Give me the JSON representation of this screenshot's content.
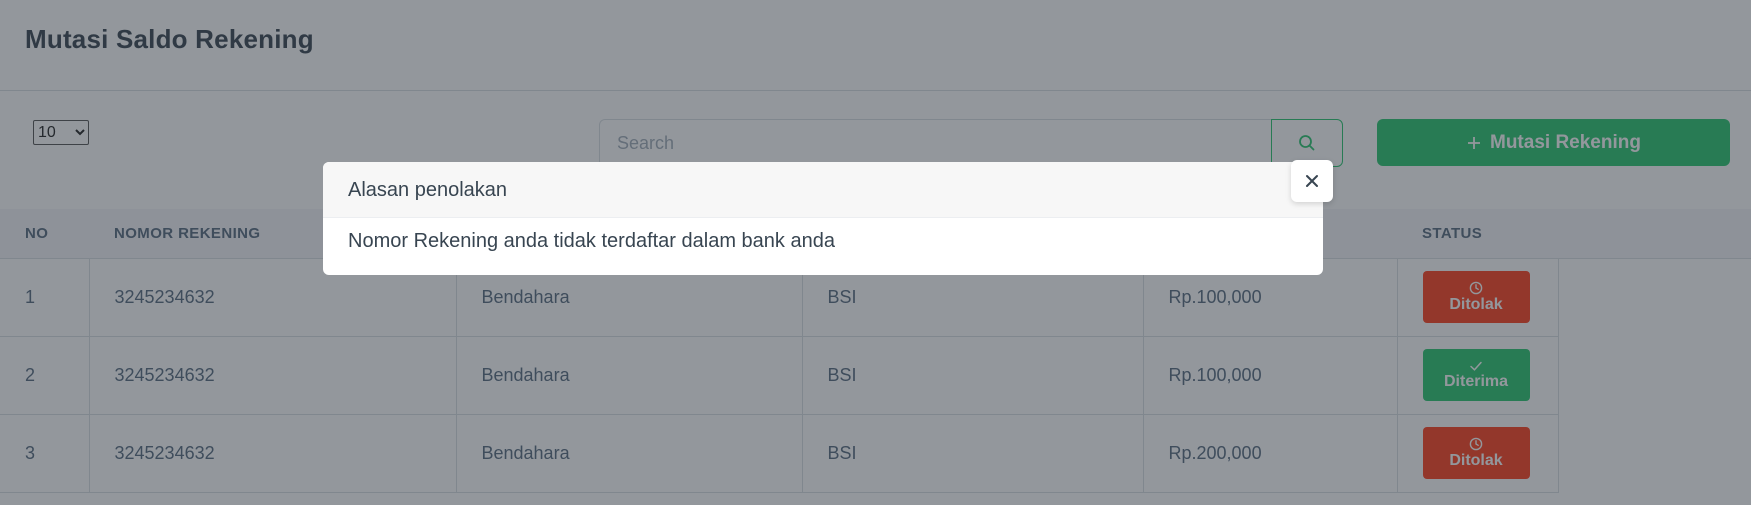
{
  "page": {
    "title": "Mutasi Saldo Rekening"
  },
  "toolbar": {
    "page_size": "10",
    "page_size_options": [
      "10"
    ],
    "search_placeholder": "Search",
    "search_value": "",
    "search_icon": "search-icon",
    "add_button_label": "Mutasi Rekening",
    "add_icon": "plus-icon",
    "accent_color": "#28c76f"
  },
  "table": {
    "columns": [
      "NO",
      "NOMOR REKENING",
      "",
      "",
      "",
      "STATUS"
    ],
    "rows": [
      {
        "no": "1",
        "nomor_rekening": "3245234632",
        "nama": "Bendahara",
        "bank": "BSI",
        "nominal": "Rp.100,000",
        "status": "Ditolak",
        "status_icon": "clock-icon",
        "status_color": "#ff3e1d"
      },
      {
        "no": "2",
        "nomor_rekening": "3245234632",
        "nama": "Bendahara",
        "bank": "BSI",
        "nominal": "Rp.100,000",
        "status": "Diterima",
        "status_icon": "check-icon",
        "status_color": "#28c76f"
      },
      {
        "no": "3",
        "nomor_rekening": "3245234632",
        "nama": "Bendahara",
        "bank": "BSI",
        "nominal": "Rp.200,000",
        "status": "Ditolak",
        "status_icon": "clock-icon",
        "status_color": "#ff3e1d"
      }
    ]
  },
  "modal": {
    "title": "Alasan penolakan",
    "message": "Nomor Rekening anda tidak terdaftar dalam bank anda",
    "close_icon": "close-icon"
  }
}
